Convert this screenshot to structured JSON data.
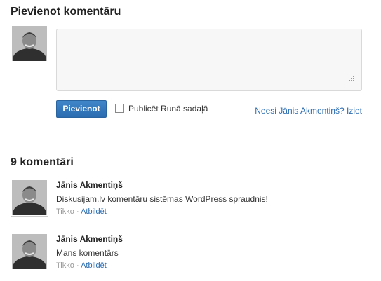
{
  "form": {
    "heading": "Pievienot komentāru",
    "submit_label": "Pievienot",
    "publish_checkbox_label": "Publicēt Runā sadaļā",
    "logout_link": "Neesi Jānis Akmentiņš? Iziet",
    "textarea_value": ""
  },
  "comments_heading": "9 komentāri",
  "comments": [
    {
      "author": "Jānis Akmentiņš",
      "text": "Diskusijam.lv komentāru sistēmas WordPress spraudnis!",
      "time": "Tikko",
      "separator": "·",
      "reply_label": "Atbildēt"
    },
    {
      "author": "Jānis Akmentiņš",
      "text": "Mans komentārs",
      "time": "Tikko",
      "separator": "·",
      "reply_label": "Atbildēt"
    }
  ],
  "colors": {
    "link": "#2b6cb0",
    "button": "#2f74b8"
  },
  "icons": {
    "avatar": "user-photo-icon",
    "resize": "resize-grip-icon"
  }
}
